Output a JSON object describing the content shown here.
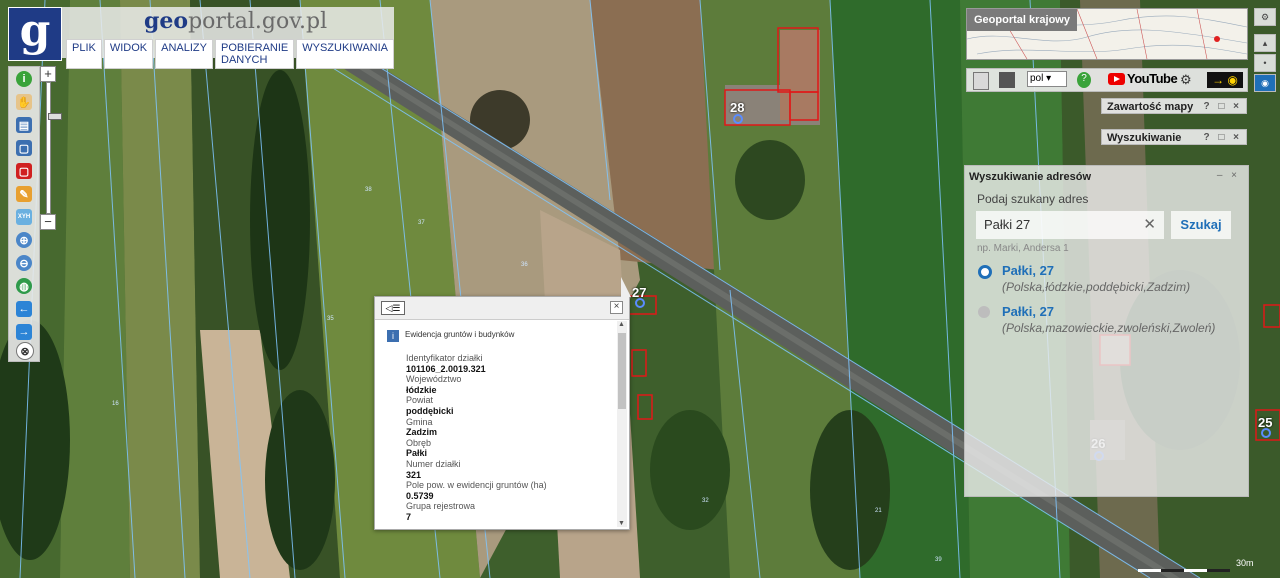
{
  "header": {
    "logo_letter": "g",
    "site_title_prefix": "geo",
    "site_title_rest": "portal.gov.pl",
    "menu": [
      "PLIK",
      "WIDOK",
      "ANALIZY",
      "POBIERANIE DANYCH",
      "WYSZUKIWANIA"
    ]
  },
  "left_toolbar": {
    "icons": [
      "info-icon",
      "pan-hand-icon",
      "layers-list-icon",
      "select-area-icon",
      "select-remove-icon",
      "pencil-icon",
      "xyz-coordinates-icon",
      "zoom-in-icon",
      "zoom-out-icon",
      "globe-icon",
      "back-arrow-icon",
      "forward-arrow-icon",
      "scale-reset-icon"
    ],
    "xyz_label": "XYH",
    "zoom_in": "+",
    "zoom_out": "−"
  },
  "popup": {
    "section_title": "Ewidencja gruntów i budynków",
    "attributes": [
      {
        "key": "Identyfikator działki",
        "value": "101106_2.0019.321"
      },
      {
        "key": "Województwo",
        "value": "łódzkie"
      },
      {
        "key": "Powiat",
        "value": "poddębicki"
      },
      {
        "key": "Gmina",
        "value": "Zadzim"
      },
      {
        "key": "Obręb",
        "value": "Pałki"
      },
      {
        "key": "Numer działki",
        "value": "321"
      },
      {
        "key": "Pole pow. w ewidencji gruntów (ha)",
        "value": "0.5739"
      },
      {
        "key": "Grupa rejestrowa",
        "value": "7"
      }
    ]
  },
  "overview": {
    "title": "Geoportal krajowy"
  },
  "right_toolbar": {
    "lang": "pol",
    "youtube_label": "YouTube"
  },
  "panels": {
    "map_contents": "Zawartość mapy",
    "search": "Wyszukiwanie"
  },
  "address_search": {
    "title": "Wyszukiwanie adresów",
    "label": "Podaj szukany adres",
    "input_value": "Pałki 27",
    "button": "Szukaj",
    "hint": "np. Marki, Andersa 1",
    "results": [
      {
        "name": "Pałki, 27",
        "desc": "(Polska,łódzkie,poddębicki,Zadzim)",
        "selected": true
      },
      {
        "name": "Pałki, 27",
        "desc": "(Polska,mazowieckie,zwoleński,Zwoleń)",
        "selected": false
      }
    ]
  },
  "map": {
    "plot_labels": [
      "28",
      "27",
      "26",
      "25"
    ],
    "parcel_numbers": [
      "38",
      "37",
      "36",
      "35",
      "16",
      "32",
      "39",
      "21"
    ],
    "scale_label": "30m"
  },
  "colors": {
    "brand": "#1f3b86",
    "link": "#1f6fb8",
    "parcel_outline": "#e01818",
    "cadastral_line": "#7fc6ff"
  }
}
